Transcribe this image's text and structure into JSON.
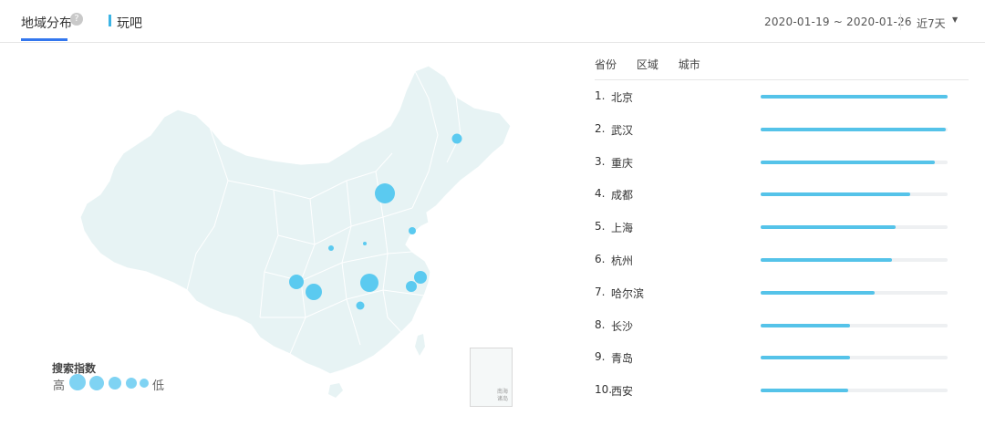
{
  "header": {
    "tab_title": "地域分布",
    "help": "?",
    "keyword": "玩吧",
    "date_range": "2020-01-19 ~ 2020-01-26",
    "period": "近7天",
    "caret": "▼"
  },
  "legend": {
    "title": "搜索指数",
    "high": "高",
    "low": "低"
  },
  "inset": {
    "label": "南海诸岛"
  },
  "subtabs": [
    "省份",
    "区域",
    "城市"
  ],
  "ranking": [
    {
      "rank": "1.",
      "city": "北京",
      "value": 1.0
    },
    {
      "rank": "2.",
      "city": "武汉",
      "value": 0.99
    },
    {
      "rank": "3.",
      "city": "重庆",
      "value": 0.93
    },
    {
      "rank": "4.",
      "city": "成都",
      "value": 0.8
    },
    {
      "rank": "5.",
      "city": "上海",
      "value": 0.72
    },
    {
      "rank": "6.",
      "city": "杭州",
      "value": 0.7
    },
    {
      "rank": "7.",
      "city": "哈尔滨",
      "value": 0.61
    },
    {
      "rank": "8.",
      "city": "长沙",
      "value": 0.48
    },
    {
      "rank": "9.",
      "city": "青岛",
      "value": 0.48
    },
    {
      "rank": "10.",
      "city": "西安",
      "value": 0.47
    }
  ],
  "colors": {
    "bar": "#55c3e9",
    "bubble": "#5bcaf0",
    "map": "#e7f3f4",
    "accent": "#3377ee"
  }
}
